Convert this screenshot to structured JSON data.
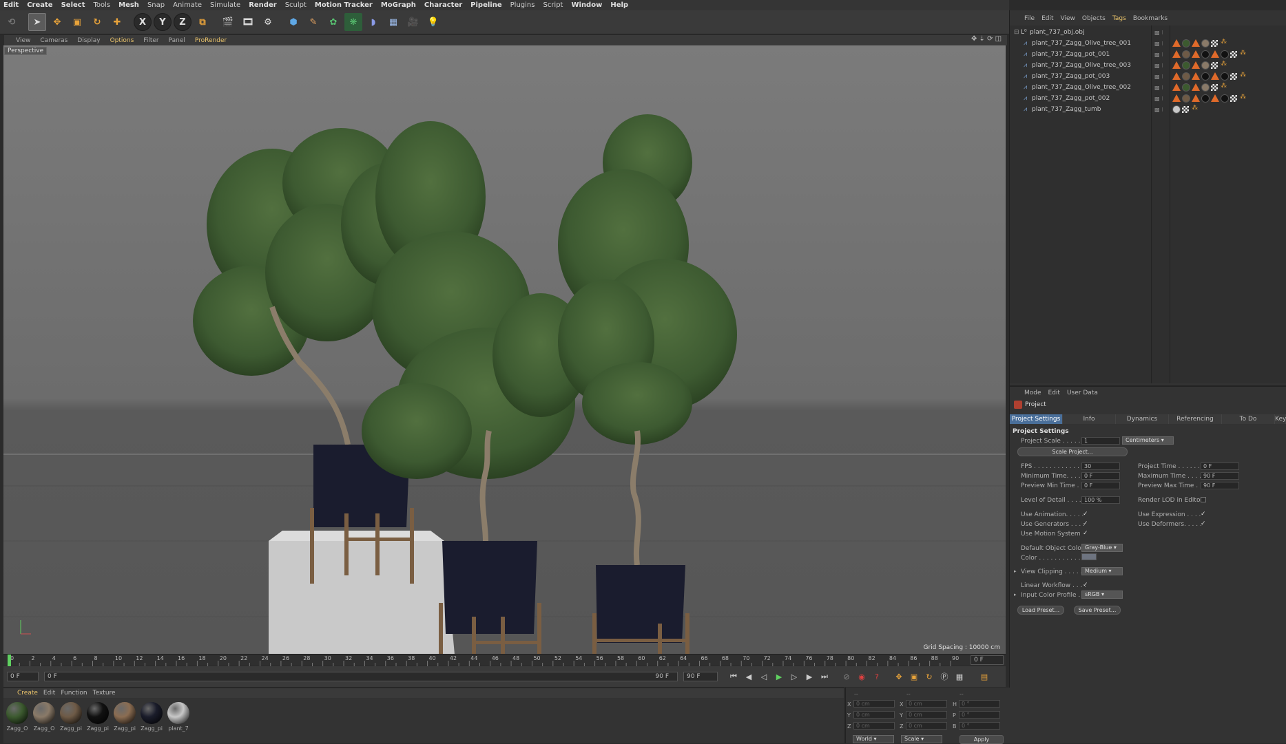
{
  "menubar": [
    "Edit",
    "Create",
    "Select",
    "Tools",
    "Mesh",
    "Snap",
    "Animate",
    "Simulate",
    "Render",
    "Sculpt",
    "Motion Tracker",
    "MoGraph",
    "Character",
    "Pipeline",
    "Plugins",
    "Script",
    "Window",
    "Help"
  ],
  "toolbar": {
    "axes": [
      "X",
      "Y",
      "Z"
    ]
  },
  "viewport": {
    "menu": [
      "View",
      "Cameras",
      "Display",
      "Options",
      "Filter",
      "Panel",
      "ProRender"
    ],
    "label": "Perspective",
    "grid_spacing": "Grid Spacing : 10000 cm"
  },
  "timeline": {
    "ticks": [
      "0",
      "2",
      "4",
      "6",
      "8",
      "10",
      "12",
      "14",
      "16",
      "18",
      "20",
      "22",
      "24",
      "26",
      "28",
      "30",
      "32",
      "34",
      "36",
      "38",
      "40",
      "42",
      "44",
      "46",
      "48",
      "50",
      "52",
      "54",
      "56",
      "58",
      "60",
      "62",
      "64",
      "66",
      "68",
      "70",
      "72",
      "74",
      "76",
      "78",
      "80",
      "82",
      "84",
      "86",
      "88",
      "90"
    ],
    "current_frame": "0 F",
    "start_field": "0 F",
    "range_start": "0 F",
    "range_end": "90 F",
    "end_field": "90 F"
  },
  "materials": {
    "menu": [
      "Create",
      "Edit",
      "Function",
      "Texture"
    ],
    "items": [
      {
        "name": "Zagg_O",
        "color": "#3c5a2f"
      },
      {
        "name": "Zagg_O",
        "color": "#8a7a68"
      },
      {
        "name": "Zagg_pi",
        "color": "#6e5a46"
      },
      {
        "name": "Zagg_pi",
        "color": "#111111"
      },
      {
        "name": "Zagg_pi",
        "color": "#8b6d52"
      },
      {
        "name": "Zagg_pi",
        "color": "#1a1c2a"
      },
      {
        "name": "plant_7",
        "color": "#c8c8c8"
      }
    ]
  },
  "coords": {
    "header": [
      "--",
      "--",
      "--"
    ],
    "rows": [
      {
        "a": "X",
        "av": "0 cm",
        "b": "X",
        "bv": "0 cm",
        "c": "H",
        "cv": "0 °"
      },
      {
        "a": "Y",
        "av": "0 cm",
        "b": "Y",
        "bv": "0 cm",
        "c": "P",
        "cv": "0 °"
      },
      {
        "a": "Z",
        "av": "0 cm",
        "b": "Z",
        "bv": "0 cm",
        "c": "B",
        "cv": "0 °"
      }
    ],
    "world": "World",
    "scale": "Scale",
    "apply": "Apply"
  },
  "objects": {
    "menu": [
      "File",
      "Edit",
      "View",
      "Objects",
      "Tags",
      "Bookmarks"
    ],
    "root": "plant_737_obj.obj",
    "items": [
      "plant_737_Zagg_Olive_tree_001",
      "plant_737_Zagg_pot_001",
      "plant_737_Zagg_Olive_tree_003",
      "plant_737_Zagg_pot_003",
      "plant_737_Zagg_Olive_tree_002",
      "plant_737_Zagg_pot_002",
      "plant_737_Zagg_tumb"
    ]
  },
  "attributes": {
    "menu": [
      "Mode",
      "Edit",
      "User Data"
    ],
    "title": "Project",
    "tabs": [
      "Project Settings",
      "Info",
      "Dynamics",
      "Referencing",
      "To Do",
      "Key"
    ],
    "section": "Project Settings",
    "project_scale_label": "Project Scale . . . . . .",
    "project_scale_value": "1",
    "project_scale_unit": "Centimeters",
    "scale_project": "Scale Project...",
    "fps_label": "FPS . . . . . . . . . . . . .",
    "fps": "30",
    "project_time_label": "Project Time . . . . . .",
    "project_time": "0 F",
    "min_time_label": "Minimum Time. . . . . .",
    "min_time": "0 F",
    "max_time_label": "Maximum Time . . . . .",
    "max_time": "90 F",
    "prev_min_label": "Preview Min Time . . .",
    "prev_min": "0 F",
    "prev_max_label": "Preview Max Time . . .",
    "prev_max": "90 F",
    "lod_label": "Level of Detail . . . . .",
    "lod": "100 %",
    "render_lod_label": "Render LOD in Editor",
    "use_anim": "Use Animation. . . . .",
    "use_expr": "Use Expression . . . .",
    "use_gen": "Use Generators . . . .",
    "use_def": "Use Deformers. . . . .",
    "use_motion": "Use Motion System",
    "def_obj_color_label": "Default Object Color",
    "def_obj_color": "Gray-Blue",
    "color_label": "Color . . . . . . . . . . . .",
    "view_clip_label": "View Clipping . . . . .",
    "view_clip": "Medium",
    "linear_label": "Linear Workflow . . . .",
    "input_color_label": "Input Color Profile . .",
    "input_color": "sRGB",
    "load_preset": "Load Preset...",
    "save_preset": "Save Preset...",
    "check": "✓"
  },
  "colors": {
    "accent": "#e8c26a",
    "tab_active": "#4a6f9a",
    "pot": "#1a1c2e",
    "foliage": "#3d5a31"
  }
}
